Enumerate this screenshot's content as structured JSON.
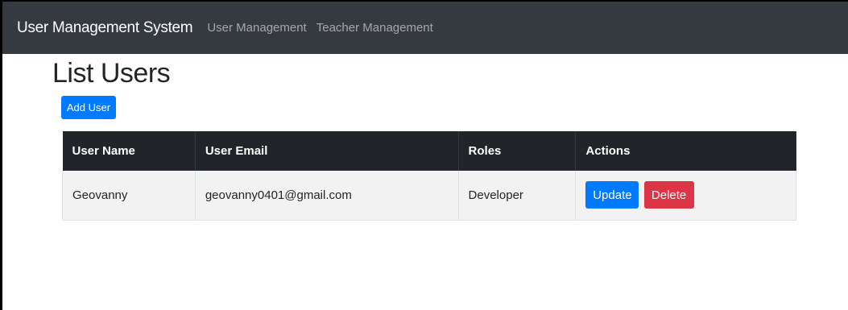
{
  "navbar": {
    "brand": "User Management System",
    "links": [
      "User Management",
      "Teacher Management"
    ]
  },
  "page": {
    "title": "List Users",
    "add_button": "Add User"
  },
  "table": {
    "headers": [
      "User Name",
      "User Email",
      "Roles",
      "Actions"
    ],
    "rows": [
      {
        "name": "Geovanny",
        "email": "geovanny0401@gmail.com",
        "role": "Developer",
        "update_label": "Update",
        "delete_label": "Delete"
      }
    ]
  },
  "colors": {
    "navbar": "#343a40",
    "primary": "#007bff",
    "danger": "#dc3545",
    "table_header": "#212529"
  }
}
